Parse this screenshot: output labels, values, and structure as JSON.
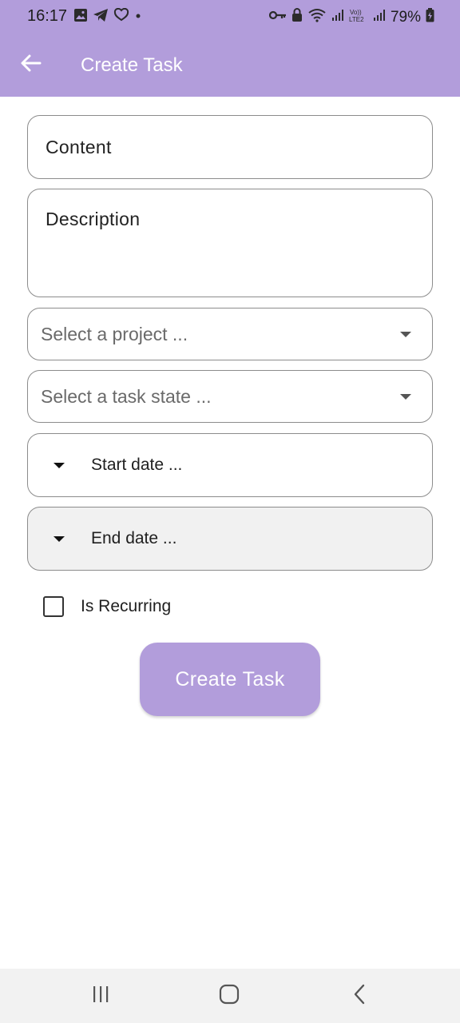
{
  "status_bar": {
    "time": "16:17",
    "battery": "79%",
    "left_icons": [
      "gallery-icon",
      "telegram-icon",
      "heart-chat-icon",
      "dot-icon"
    ],
    "right_icons": [
      "key-icon",
      "lock-icon",
      "wifi-icon",
      "signal-icon",
      "volte-icon",
      "signal-icon",
      "battery-icon"
    ]
  },
  "app_bar": {
    "title": "Create Task",
    "background": "#b29ddb"
  },
  "form": {
    "content_label": "Content",
    "description_label": "Description",
    "project_placeholder": "Select a project ...",
    "task_state_placeholder": "Select a task state ...",
    "start_date_label": "Start date ...",
    "end_date_label": "End date ...",
    "recurring_label": "Is Recurring",
    "recurring_checked": false
  },
  "submit": {
    "label": "Create Task"
  },
  "nav_bar": {
    "buttons": [
      "recents-icon",
      "home-icon",
      "back-icon"
    ]
  }
}
